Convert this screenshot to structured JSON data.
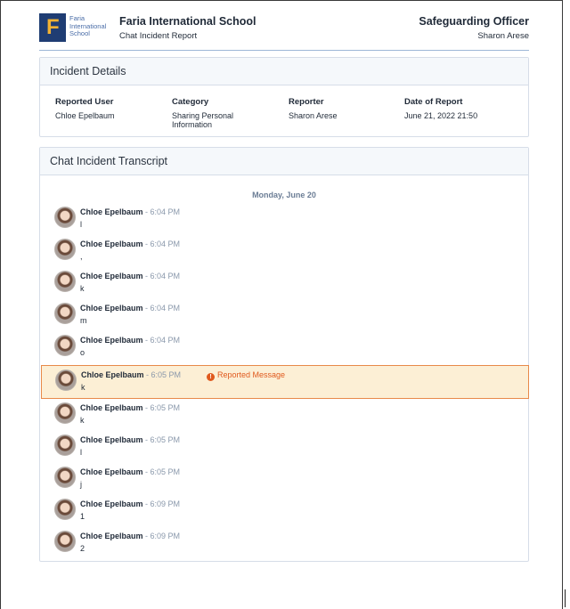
{
  "header": {
    "logo_lines": [
      "Faria",
      "International",
      "School"
    ],
    "school_name": "Faria International School",
    "report_title": "Chat Incident Report",
    "role": "Safeguarding Officer",
    "officer_name": "Sharon Arese"
  },
  "details": {
    "title": "Incident Details",
    "fields": [
      {
        "label": "Reported User",
        "value": "Chloe Epelbaum"
      },
      {
        "label": "Category",
        "value": "Sharing Personal Information"
      },
      {
        "label": "Reporter",
        "value": "Sharon Arese"
      },
      {
        "label": "Date of Report",
        "value": "June 21, 2022 21:50"
      }
    ]
  },
  "transcript": {
    "title": "Chat Incident Transcript",
    "day": "Monday, June 20",
    "reported_label": "Reported Message",
    "messages": [
      {
        "sender": "Chloe Epelbaum",
        "time": "- 6:04 PM",
        "text": "l"
      },
      {
        "sender": "Chloe Epelbaum",
        "time": "- 6:04 PM",
        "text": ","
      },
      {
        "sender": "Chloe Epelbaum",
        "time": "- 6:04 PM",
        "text": "k"
      },
      {
        "sender": "Chloe Epelbaum",
        "time": "- 6:04 PM",
        "text": "m"
      },
      {
        "sender": "Chloe Epelbaum",
        "time": "- 6:04 PM",
        "text": "o"
      },
      {
        "sender": "Chloe Epelbaum",
        "time": "- 6:05 PM",
        "text": "k",
        "reported": true
      },
      {
        "sender": "Chloe Epelbaum",
        "time": "- 6:05 PM",
        "text": "k"
      },
      {
        "sender": "Chloe Epelbaum",
        "time": "- 6:05 PM",
        "text": "l"
      },
      {
        "sender": "Chloe Epelbaum",
        "time": "- 6:05 PM",
        "text": "j"
      },
      {
        "sender": "Chloe Epelbaum",
        "time": "- 6:09 PM",
        "text": "1"
      },
      {
        "sender": "Chloe Epelbaum",
        "time": "- 6:09 PM",
        "text": "2"
      }
    ]
  },
  "icons": {
    "warning": "warning-icon"
  }
}
